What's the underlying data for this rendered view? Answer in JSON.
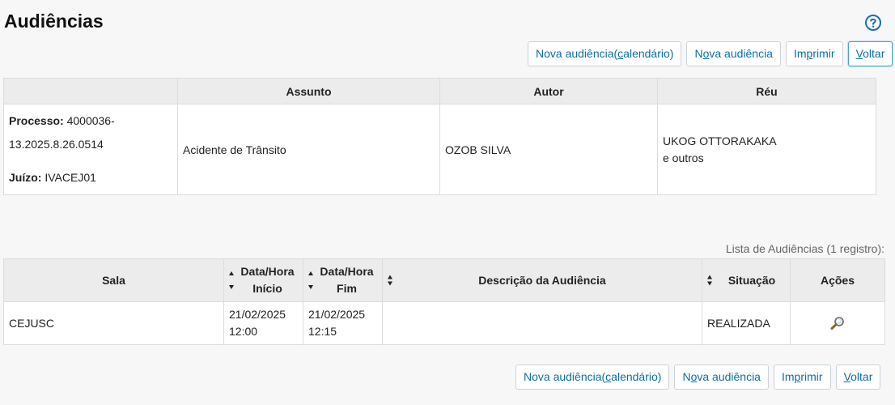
{
  "page": {
    "title": "Audiências"
  },
  "toolbar_top": {
    "nova_cal_prefix": "Nova audiência(",
    "nova_cal_underlined": "c",
    "nova_cal_suffix": "alendário)",
    "nova_prefix": "N",
    "nova_underlined": "o",
    "nova_suffix": "va audiência",
    "imprimir_prefix": "Im",
    "imprimir_underlined": "p",
    "imprimir_suffix": "rimir",
    "voltar_underlined": "V",
    "voltar_suffix": "oltar"
  },
  "process_table": {
    "headers": {
      "assunto": "Assunto",
      "autor": "Autor",
      "reu": "Réu"
    },
    "processo_label": "Processo:",
    "processo_value": "4000036-",
    "processo_value_2": "13.2025.8.26.0514",
    "juizo_label": "Juízo:",
    "juizo_value": "IVACEJ01",
    "assunto": "Acidente de Trânsito",
    "autor": "OZOB SILVA",
    "reu_line1": "UKOG OTTORAKAKA",
    "reu_line2": "e outros"
  },
  "list_caption": "Lista de Audiências (1 registro):",
  "hearings_table": {
    "headers": {
      "sala": "Sala",
      "inicio_1": "Data/Hora",
      "inicio_2": "Início",
      "fim_1": "Data/Hora",
      "fim_2": "Fim",
      "descricao": "Descrição da Audiência",
      "situacao": "Situação",
      "acoes": "Ações"
    },
    "rows": [
      {
        "sala": "CEJUSC",
        "inicio_data": "21/02/2025",
        "inicio_hora": "12:00",
        "fim_data": "21/02/2025",
        "fim_hora": "12:15",
        "descricao": "",
        "situacao": "REALIZADA",
        "acao_icon": "magnifier-icon"
      }
    ]
  },
  "colors": {
    "link": "#0a6ea6",
    "header_bg": "#ececec",
    "page_bg": "#f7f7f7"
  }
}
